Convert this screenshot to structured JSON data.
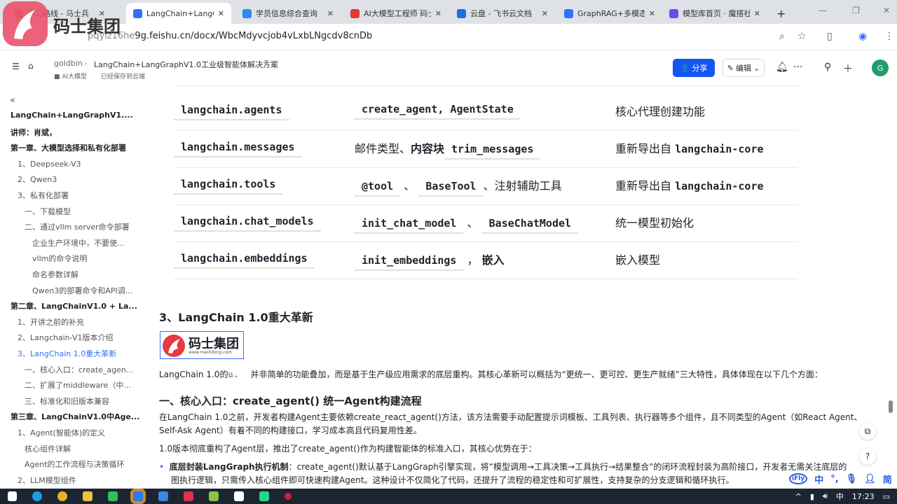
{
  "browser": {
    "tabs": [
      {
        "title": "学习路线 - 马士兵",
        "color": "#e74c3c"
      },
      {
        "title": "LangChain+LangGraph",
        "color": "#3370ff",
        "active": true
      },
      {
        "title": "学员信息综合查询",
        "color": "#2a8cf0"
      },
      {
        "title": "AI大模型工程师 码士",
        "color": "#e53935"
      },
      {
        "title": "云盘 - 飞书云文档",
        "color": "#1f6fe0"
      },
      {
        "title": "GraphRAG+多模态",
        "color": "#3370ff"
      },
      {
        "title": "模型库首页 · 魔搭社区",
        "color": "#6a4cf0"
      }
    ],
    "new_tab": "+",
    "url_dim": "pqyiz16he",
    "url": "9g.feishu.cn/docx/WbcMdyvcjob4vLxbLNgcdv8cnDb"
  },
  "logo": {
    "text": "码士集团",
    "sub": "www.mashibing.com"
  },
  "doc": {
    "breadcrumb_root": "goldbin",
    "title": "LangChain+LangGraphV1.0工业级智能体解决方案",
    "folder": "AI大模型",
    "save_status": "已经保存到云端",
    "share": "分享",
    "edit": "编辑",
    "avatar": "G"
  },
  "toc": [
    {
      "label": "LangChain+LangGraphV1....",
      "level": 0
    },
    {
      "label": "讲师：肖斌，",
      "level": 0
    },
    {
      "label": "第一章、大模型选择和私有化部署",
      "level": 0
    },
    {
      "label": "1、Deepseek-V3",
      "level": 1
    },
    {
      "label": "2、Qwen3",
      "level": 1
    },
    {
      "label": "3、私有化部署",
      "level": 1
    },
    {
      "label": "一、下载模型",
      "level": 2
    },
    {
      "label": "二、通过vllm server命令部署",
      "level": 2
    },
    {
      "label": "企业生产环境中，不要使...",
      "level": 3
    },
    {
      "label": "vllm的命令说明",
      "level": 3
    },
    {
      "label": "命名参数详解",
      "level": 3
    },
    {
      "label": "Qwen3的部署命令和API调...",
      "level": 3
    },
    {
      "label": "第二章、LangChainV1.0 + La...",
      "level": 0
    },
    {
      "label": "1、开讲之前的补充",
      "level": 1
    },
    {
      "label": "2、Langchain-V1版本介绍",
      "level": 1
    },
    {
      "label": "3、LangChain 1.0重大革新",
      "level": 1,
      "active": true
    },
    {
      "label": "一、核心入口：create_agen...",
      "level": 2
    },
    {
      "label": "二、扩展了middleware（中...",
      "level": 2
    },
    {
      "label": "三、标准化和旧版本兼容",
      "level": 2
    },
    {
      "label": "第三章、LangChainV1.0中Age...",
      "level": 0
    },
    {
      "label": "1、Agent(智能体)的定义",
      "level": 1
    },
    {
      "label": "核心组件详解",
      "level": 2
    },
    {
      "label": "Agent的工作流程与决策循环",
      "level": 2
    },
    {
      "label": "2、LLM模型组件",
      "level": 1
    }
  ],
  "table": [
    {
      "module": "langchain.agents",
      "exports": [
        {
          "t": "create_agent, AgentState",
          "code": true
        }
      ],
      "desc": [
        {
          "t": "核心代理创建功能"
        }
      ]
    },
    {
      "module": "langchain.messages",
      "exports": [
        {
          "t": "邮件类型、"
        },
        {
          "t": "内容块",
          "bold": true
        },
        {
          "t": "trim_messages",
          "code": true
        }
      ],
      "desc": [
        {
          "t": "重新导出自 "
        },
        {
          "t": "langchain-core",
          "mono": true
        }
      ]
    },
    {
      "module": "langchain.tools",
      "exports": [
        {
          "t": "@tool",
          "code": true
        },
        {
          "t": " 、 "
        },
        {
          "t": "BaseTool",
          "code": true
        },
        {
          "t": "、注射辅助工具"
        }
      ],
      "desc": [
        {
          "t": "重新导出自 "
        },
        {
          "t": "langchain-core",
          "mono": true
        }
      ]
    },
    {
      "module": "langchain.chat_models",
      "exports": [
        {
          "t": "init_chat_model",
          "code": true
        },
        {
          "t": " 、 "
        },
        {
          "t": "BaseChatModel",
          "code": true
        }
      ],
      "desc": [
        {
          "t": "统一模型初始化"
        }
      ]
    },
    {
      "module": "langchain.embeddings",
      "exports": [
        {
          "t": "init_embeddings",
          "code": true
        },
        {
          "t": " ， "
        },
        {
          "t": "嵌入",
          "bold": true
        }
      ],
      "desc": [
        {
          "t": "嵌入模型"
        }
      ]
    }
  ],
  "body": {
    "h3": "3、LangChain 1.0重大革新",
    "intro_a": "LangChain 1.0的",
    "intro_b": "并非简单的功能叠加，而是基于生产级应用需求的底层重构。其核心革新可以概括为“更统一、更可控、更生产就绪”三大特性，具体体现在以下几个方面：",
    "h4": "一、核心入口：create_agent() 统一Agent构建流程",
    "p1": "在LangChain 1.0之前，开发者构建Agent主要依赖create_react_agent()方法，该方法需要手动配置提示词模板、工具列表、执行器等多个组件，且不同类型的Agent（如React Agent、",
    "p1b": "Self-Ask Agent）有着不同的构建接口，学习成本高且代码复用性差。",
    "p2": "1.0版本彻底重构了Agent层，推出了create_agent()作为构建智能体的标准入口，其核心优势在于：",
    "bullet_bold": "底层封装LangGraph执行机制",
    "bullet": "：create_agent()默认基于LangGraph引擎实现，将“模型调用→工具决策→工具执行→结果整合”的闭环流程封装为高阶接口，开发者无需关注底层的",
    "bullet2": "图执行逻辑，只需传入核心组件即可快速构建Agent。这种设计不仅简化了代码，还提升了流程的稳定性和可扩展性，支持复杂的分支逻辑和循环执行。"
  },
  "ime": {
    "lang": "中",
    "mode": "简"
  },
  "clock": "17:23",
  "tray_lang": "中"
}
